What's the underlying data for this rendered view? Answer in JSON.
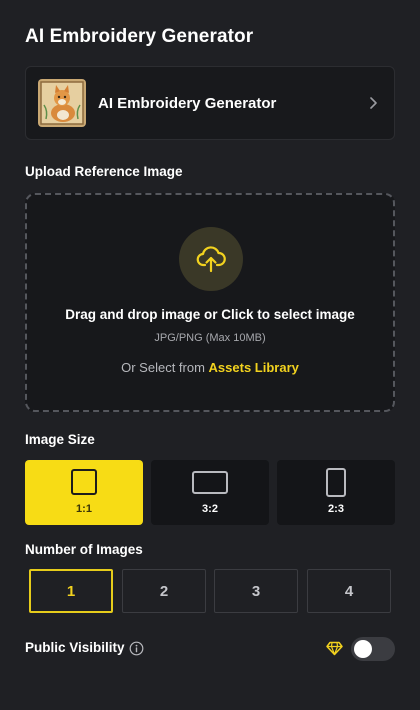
{
  "header": {
    "title": "AI Embroidery Generator"
  },
  "model_card": {
    "name": "AI Embroidery Generator",
    "thumbnail": "cat-embroidery-thumbnail",
    "chevron_icon": "chevron-right-icon"
  },
  "upload": {
    "label": "Upload Reference Image",
    "icon": "cloud-upload-icon",
    "title": "Drag and drop image or Click to select image",
    "hint": "JPG/PNG (Max 10MB)",
    "assets_prefix": "Or Select from",
    "assets_link": "Assets Library"
  },
  "image_size": {
    "label": "Image Size",
    "selected": "1:1",
    "options": [
      {
        "label": "1:1",
        "active": true
      },
      {
        "label": "3:2",
        "active": false
      },
      {
        "label": "2:3",
        "active": false
      }
    ]
  },
  "number_of_images": {
    "label": "Number of Images",
    "selected": 1,
    "options": [
      "1",
      "2",
      "3",
      "4"
    ]
  },
  "visibility": {
    "label": "Public Visibility",
    "info_icon": "info-icon",
    "premium_icon": "diamond-icon",
    "enabled": false
  },
  "colors": {
    "background": "#1f2024",
    "accent": "#f7dc15",
    "accent_text": "#f2d21f"
  }
}
